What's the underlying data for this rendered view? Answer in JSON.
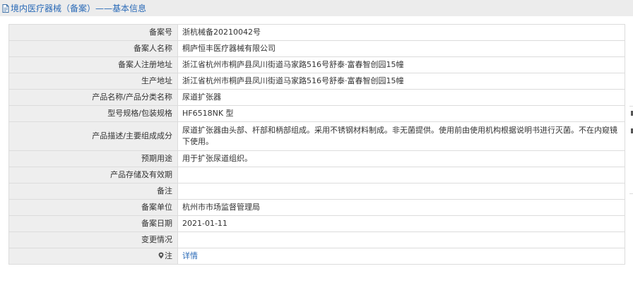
{
  "header": {
    "title": "境内医疗器械（备案）——基本信息",
    "icon": "document-icon"
  },
  "rows": [
    {
      "label": "备案号",
      "value": "浙杭械备20210042号"
    },
    {
      "label": "备案人名称",
      "value": "桐庐恒丰医疗器械有限公司"
    },
    {
      "label": "备案人注册地址",
      "value": "浙江省杭州市桐庐县凤川街道马家路516号舒泰·富春智创园15幢"
    },
    {
      "label": "生产地址",
      "value": "浙江省杭州市桐庐县凤川街道马家路516号舒泰·富春智创园15幢"
    },
    {
      "label": "产品名称/产品分类名称",
      "value": "尿道扩张器"
    },
    {
      "label": "型号规格/包装规格",
      "value": "HF6518NK 型"
    },
    {
      "label": "产品描述/主要组成成分",
      "value": "尿道扩张器由头部、杆部和柄部组成。采用不锈钢材料制成。非无菌提供。使用前由使用机构根据说明书进行灭菌。不在内窥镜下使用。"
    },
    {
      "label": "预期用途",
      "value": "用于扩张尿道组织。"
    },
    {
      "label": "产品存储及有效期",
      "value": ""
    },
    {
      "label": "备注",
      "value": ""
    },
    {
      "label": "备案单位",
      "value": "杭州市市场监督管理局"
    },
    {
      "label": "备案日期",
      "value": "2021-01-11"
    },
    {
      "label": "变更情况",
      "value": ""
    },
    {
      "label": "注",
      "value": "详情"
    }
  ]
}
